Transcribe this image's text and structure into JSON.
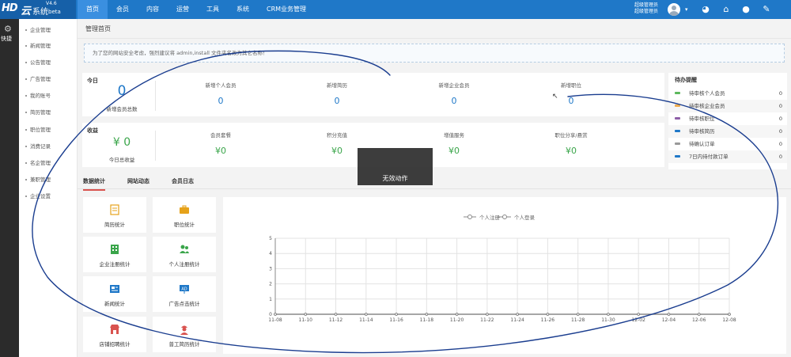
{
  "brand": {
    "hd": "HD",
    "yun": "云",
    "name": "系统",
    "version": "V4.6",
    "beta": "beta"
  },
  "nav": [
    {
      "label": "首页"
    },
    {
      "label": "会员"
    },
    {
      "label": "内容"
    },
    {
      "label": "运营"
    },
    {
      "label": "工具"
    },
    {
      "label": "系统"
    },
    {
      "label": "CRM业务管理"
    }
  ],
  "admin": {
    "line1": "超级管理员",
    "line2": "超级管理员"
  },
  "quickbar": {
    "label": "快捷"
  },
  "sidebar": [
    {
      "label": "企业管理"
    },
    {
      "label": "新闻管理"
    },
    {
      "label": "公告管理"
    },
    {
      "label": "广告管理"
    },
    {
      "label": "我的账号"
    },
    {
      "label": "简历管理"
    },
    {
      "label": "职位管理"
    },
    {
      "label": "消费记录"
    },
    {
      "label": "名企管理"
    },
    {
      "label": "兼职管理"
    },
    {
      "label": "企业设置"
    }
  ],
  "page_title": "管理首页",
  "notice": "为了您的网站安全考虑，强烈建议将 admin,install 文件夹名改为其它名称！",
  "today": {
    "title": "今日",
    "total_value": "0",
    "total_label": "新增会员总数",
    "stats": [
      {
        "label": "新增个人会员",
        "value": "0"
      },
      {
        "label": "新增简历",
        "value": "0"
      },
      {
        "label": "新增企业会员",
        "value": "0"
      },
      {
        "label": "新增职位",
        "value": "0"
      }
    ]
  },
  "income": {
    "title": "收益",
    "total_value": "¥ 0",
    "total_label": "今日总收益",
    "stats": [
      {
        "label": "会员套餐",
        "value": "¥0"
      },
      {
        "label": "积分充值",
        "value": "¥0"
      },
      {
        "label": "增值服务",
        "value": "¥0"
      },
      {
        "label": "职位分享/悬赏",
        "value": "¥0"
      }
    ]
  },
  "todo": {
    "title": "待办提醒",
    "items": [
      {
        "label": "待审核个人会员",
        "count": "0",
        "color": "#5cb85c"
      },
      {
        "label": "待审核企业会员",
        "count": "0",
        "color": "#f0ad4e"
      },
      {
        "label": "待审核职位",
        "count": "0",
        "color": "#8e5fa8"
      },
      {
        "label": "待审核简历",
        "count": "0",
        "color": "#1f78c8"
      },
      {
        "label": "待确认订单",
        "count": "0",
        "color": "#999999"
      },
      {
        "label": "7日内待付款订单",
        "count": "0",
        "color": "#1f78c8"
      }
    ]
  },
  "tabs": [
    {
      "label": "数据统计"
    },
    {
      "label": "网站动态"
    },
    {
      "label": "会员日志"
    }
  ],
  "tiles": [
    {
      "label": "简历统计",
      "icon": "resume-icon"
    },
    {
      "label": "职位统计",
      "icon": "briefcase-icon"
    },
    {
      "label": "企业注册统计",
      "icon": "building-icon"
    },
    {
      "label": "个人注册统计",
      "icon": "users-icon"
    },
    {
      "label": "新闻统计",
      "icon": "news-icon"
    },
    {
      "label": "广告点击统计",
      "icon": "ad-icon"
    },
    {
      "label": "店铺招聘统计",
      "icon": "shop-icon"
    },
    {
      "label": "普工简历统计",
      "icon": "worker-icon"
    }
  ],
  "toast": "无效动作",
  "chart_data": {
    "type": "line",
    "legend_position": "top",
    "series": [
      {
        "name": "个人注册",
        "values": [
          0,
          0,
          0,
          0,
          0,
          0,
          0,
          0,
          0,
          0,
          0,
          0,
          0,
          0,
          0,
          0
        ]
      },
      {
        "name": "个人登录",
        "values": [
          0,
          0,
          0,
          0,
          0,
          0,
          0,
          0,
          0,
          0,
          0,
          0,
          0,
          0,
          0,
          0
        ]
      }
    ],
    "categories": [
      "11-08",
      "11-10",
      "11-12",
      "11-14",
      "11-16",
      "11-18",
      "11-20",
      "11-22",
      "11-24",
      "11-26",
      "11-28",
      "11-30",
      "12-02",
      "12-04",
      "12-06",
      "12-08"
    ],
    "y_ticks": [
      "0",
      "1",
      "2",
      "3",
      "4",
      "5"
    ],
    "ylim": [
      0,
      5
    ],
    "grid": true
  }
}
